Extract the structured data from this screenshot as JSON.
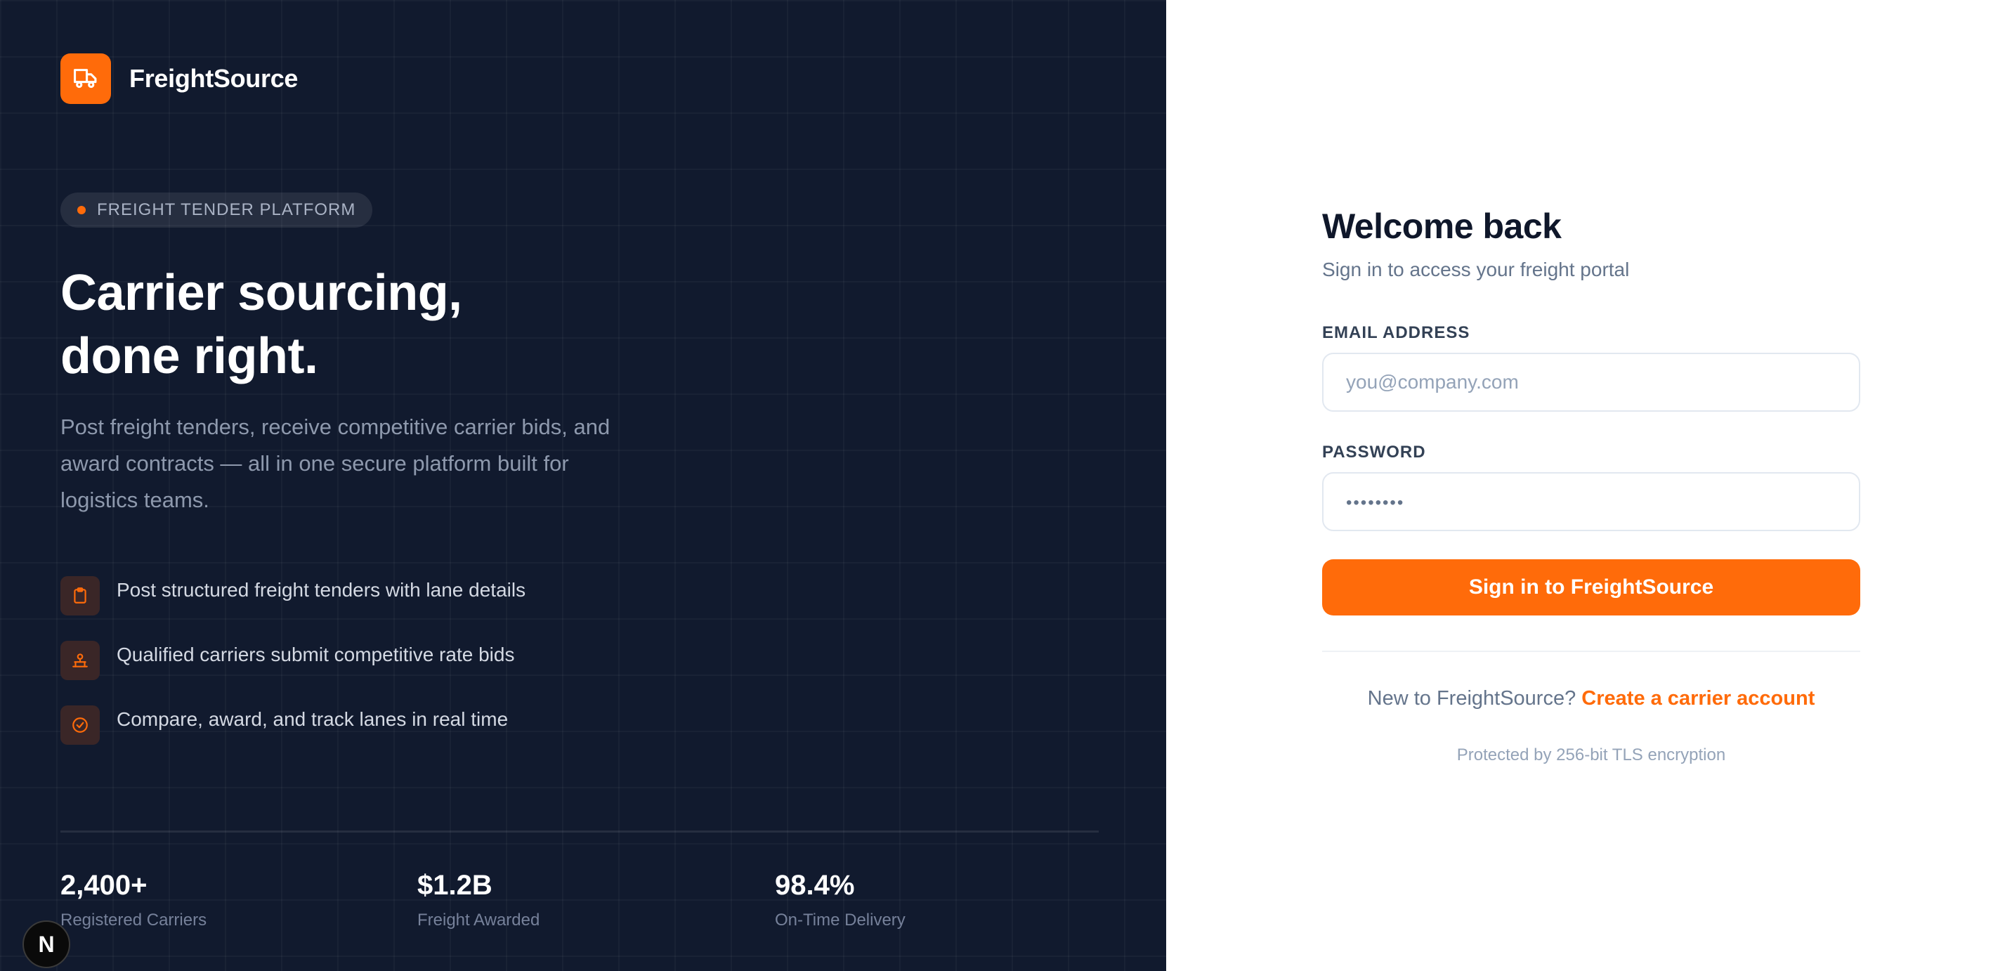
{
  "brand": {
    "name": "FreightSource",
    "logo_icon": "truck-icon",
    "accent": "#ff6b0a"
  },
  "hero": {
    "pill": "FREIGHT TENDER PLATFORM",
    "headline_line1": "Carrier sourcing,",
    "headline_line2": "done right.",
    "description": "Post freight tenders, receive competitive carrier bids, and award contracts — all in one secure platform built for logistics teams."
  },
  "features": [
    {
      "icon": "clipboard-icon",
      "text": "Post structured freight tenders with lane details"
    },
    {
      "icon": "bid-icon",
      "text": "Qualified carriers submit competitive rate bids"
    },
    {
      "icon": "check-circle-icon",
      "text": "Compare, award, and track lanes in real time"
    }
  ],
  "stats": [
    {
      "value": "2,400+",
      "label": "Registered Carriers"
    },
    {
      "value": "$1.2B",
      "label": "Freight Awarded"
    },
    {
      "value": "98.4%",
      "label": "On-Time Delivery"
    }
  ],
  "badge": {
    "letter": "N"
  },
  "form": {
    "title": "Welcome back",
    "subtitle": "Sign in to access your freight portal",
    "email_label": "EMAIL ADDRESS",
    "email_placeholder": "you@company.com",
    "password_label": "PASSWORD",
    "password_placeholder": "••••••••",
    "submit_label": "Sign in to FreightSource",
    "signup_prompt": "New to FreightSource?",
    "signup_link": "Create a carrier account",
    "security_note": "Protected by 256-bit TLS encryption"
  }
}
